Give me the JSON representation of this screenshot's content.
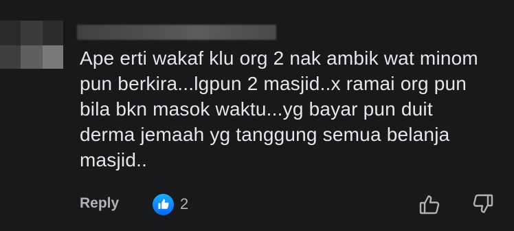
{
  "comment": {
    "text": "Ape erti wakaf klu org 2 nak ambik wat minom\npun berkira...lgpun 2 masjid..x ramai org pun\nbila bkn masok waktu...yg bayar pun duit\nderma jemaah yg tanggung semua belanja\nmasjid..",
    "reply_label": "Reply",
    "reaction_count": "2",
    "reaction_icon": "like-icon",
    "reaction_color": "#0866ff"
  },
  "actions": {
    "like_icon": "thumbs-up-icon",
    "dislike_icon": "thumbs-down-icon"
  },
  "colors": {
    "background": "#18191a",
    "text": "#e4e6eb",
    "secondary_text": "#b0b3b8"
  }
}
